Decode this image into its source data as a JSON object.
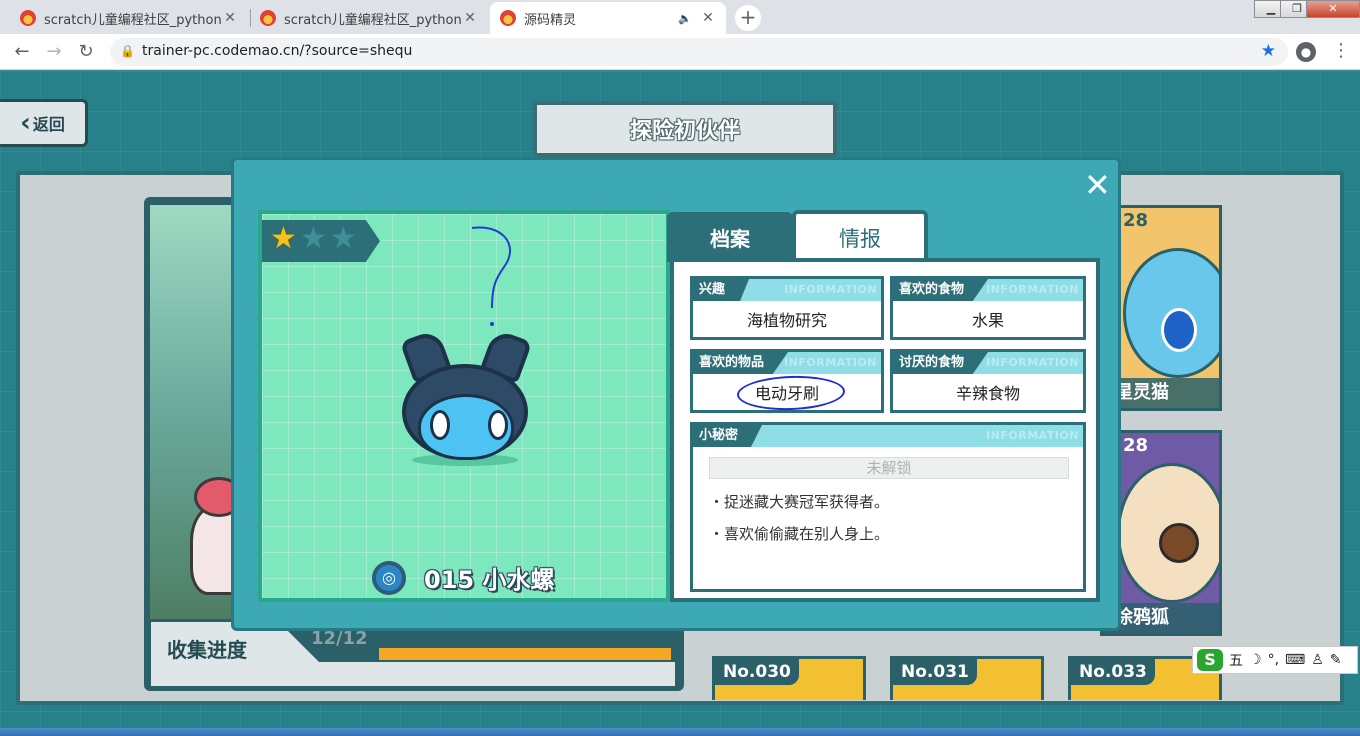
{
  "browser": {
    "tabs": [
      {
        "title": "scratch儿童编程社区_python编",
        "active": false
      },
      {
        "title": "scratch儿童编程社区_python编",
        "active": false
      },
      {
        "title": "源码精灵",
        "active": true
      }
    ],
    "url": "trainer-pc.codemao.cn/?source=shequ",
    "new_tab": "+",
    "window_controls": [
      "▁",
      "❐",
      "✕"
    ]
  },
  "game": {
    "back_label": "返回",
    "page_title": "探险初伙伴",
    "progress": {
      "label": "收集进度",
      "count": "12/12",
      "fraction": 1.0
    },
    "side_cards": [
      {
        "number": "28",
        "name": "星灵猫"
      },
      {
        "number": "28",
        "name": "涂鸦狐"
      }
    ],
    "bottom_cards": [
      "No.030",
      "No.031",
      "No.033"
    ]
  },
  "modal": {
    "close": "✕",
    "pet": {
      "stars_filled": 1,
      "stars_total": 3,
      "id_name": "015 小水螺"
    },
    "tabs": {
      "archive": "档案",
      "info": "情报"
    },
    "watermark": "INFORMATION",
    "fields": {
      "interest": {
        "label": "兴趣",
        "value": "海植物研究"
      },
      "fav_food": {
        "label": "喜欢的食物",
        "value": "水果"
      },
      "fav_item": {
        "label": "喜欢的物品",
        "value": "电动牙刷"
      },
      "hated_food": {
        "label": "讨厌的食物",
        "value": "辛辣食物"
      },
      "secret": {
        "label": "小秘密",
        "locked": "未解锁",
        "lines": [
          "・捉迷藏大赛冠军获得者。",
          "・喜欢偷偷藏在别人身上。"
        ]
      }
    }
  },
  "ime": {
    "logo": "S",
    "mode": "五",
    "items": [
      "☽",
      "°,",
      "⌨",
      "♙",
      "✎"
    ]
  },
  "colors": {
    "accent": "#3da9b4",
    "panel": "#7de7bd",
    "dark": "#2c6f78",
    "progress": "#f5a623"
  }
}
